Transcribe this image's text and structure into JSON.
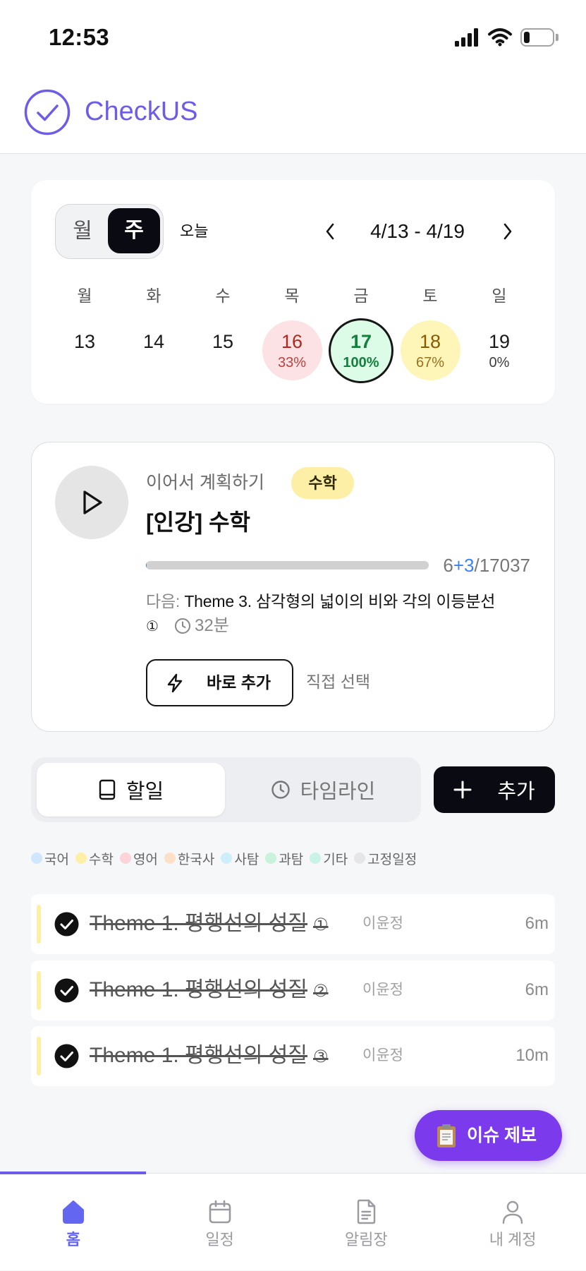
{
  "status_bar": {
    "time": "12:53",
    "battery_level": 0.2
  },
  "header": {
    "app_name": "CheckUS",
    "logo_icon": "check-circle-icon"
  },
  "colors": {
    "brand": "#6c5ce7",
    "issue_button": "#7c3aed",
    "nav_active": "#6366f1",
    "progress_added": "#3b82f6"
  },
  "calendar": {
    "view_toggle": {
      "month": "월",
      "week": "주",
      "active": "주"
    },
    "today_label": "오늘",
    "range": "4/13 - 4/19",
    "weekdays": [
      "월",
      "화",
      "수",
      "목",
      "금",
      "토",
      "일"
    ],
    "days": [
      {
        "date": "13"
      },
      {
        "date": "14"
      },
      {
        "date": "15"
      },
      {
        "date": "16",
        "percent": "33%",
        "circle_color": "#fde2e5",
        "text_color": "#b3261e"
      },
      {
        "date": "17",
        "percent": "100%",
        "circle_color": "#dcfce7",
        "text_color": "#15803d"
      },
      {
        "date": "18",
        "percent": "67%",
        "circle_color": "#fef5b8",
        "text_color": "#8a5a00"
      },
      {
        "date": "19",
        "percent": "0%"
      }
    ]
  },
  "continue_card": {
    "label": "이어서 계획하기",
    "subject": "수학",
    "subject_color": "#fdf0a6",
    "lecture": "[인강] 수학",
    "progress": {
      "completed": "6",
      "added": "+3",
      "total": "/17037"
    },
    "next_label": "다음:",
    "next_title": "Theme 3. 삼각형의 넓이의 비와 각의 이등분선",
    "next_index": "①",
    "duration": "32분",
    "quick_add": "바로 추가",
    "manual_select": "직접 선택"
  },
  "tabs": {
    "items": [
      {
        "label": "할일",
        "icon": "book-icon",
        "active": true
      },
      {
        "label": "타임라인",
        "icon": "clock-icon",
        "active": false
      }
    ],
    "add_label": "추가",
    "add_icon": "plus-icon"
  },
  "legend": [
    {
      "label": "국어",
      "color": "#cfe6fb"
    },
    {
      "label": "수학",
      "color": "#fdf0a6"
    },
    {
      "label": "영어",
      "color": "#fbd3d8"
    },
    {
      "label": "한국사",
      "color": "#fde0c8"
    },
    {
      "label": "사탐",
      "color": "#cdeefa"
    },
    {
      "label": "과탐",
      "color": "#c9f2dc"
    },
    {
      "label": "기타",
      "color": "#c8f3e6"
    },
    {
      "label": "고정일정",
      "color": "#e6e6e8"
    }
  ],
  "tasks": [
    {
      "title": "Theme 1. 평행선의 성질",
      "index": "①",
      "assignee": "이윤정",
      "duration": "6m",
      "done": true,
      "subject_color": "#fdf0a6"
    },
    {
      "title": "Theme 1. 평행선의 성질",
      "index": "②",
      "assignee": "이윤정",
      "duration": "6m",
      "done": true,
      "subject_color": "#fdf0a6"
    },
    {
      "title": "Theme 1. 평행선의 성질",
      "index": "③",
      "assignee": "이윤정",
      "duration": "10m",
      "done": true,
      "subject_color": "#fdf0a6"
    }
  ],
  "issue_button": {
    "label": "이슈 제보",
    "icon": "clipboard-icon"
  },
  "bottom_nav": {
    "items": [
      {
        "label": "홈",
        "icon": "home-icon",
        "active": true
      },
      {
        "label": "일정",
        "icon": "calendar-icon",
        "active": false
      },
      {
        "label": "알림장",
        "icon": "document-icon",
        "active": false
      },
      {
        "label": "내 계정",
        "icon": "user-icon",
        "active": false
      }
    ]
  }
}
